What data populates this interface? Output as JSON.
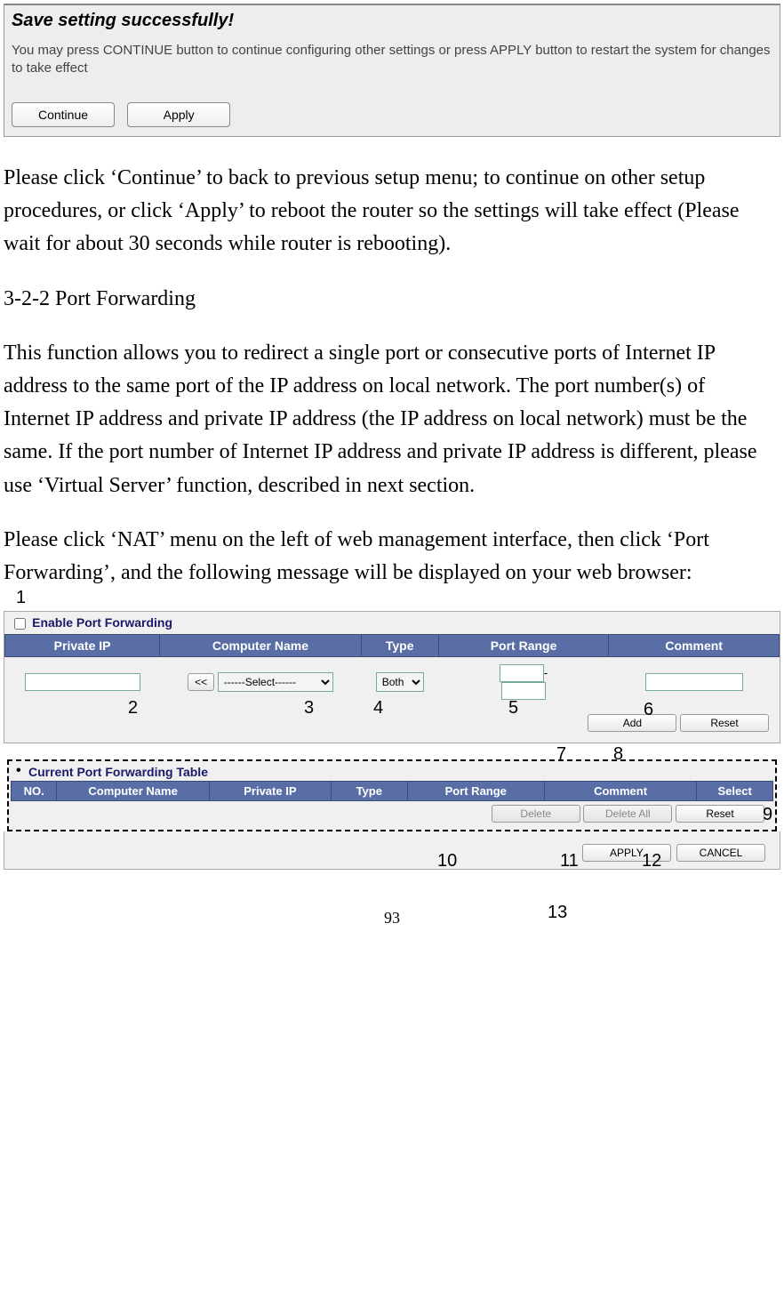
{
  "save_panel": {
    "title": "Save setting successfully!",
    "desc": "You may press CONTINUE button to continue configuring other settings or press APPLY button to restart the system for changes to take effect",
    "continue_label": "Continue",
    "apply_label": "Apply"
  },
  "para1": "Please click ‘Continue’ to back to previous setup menu; to continue on other setup procedures, or click ‘Apply’ to reboot the router so the settings will take effect (Please wait for about 30 seconds while router is rebooting).",
  "section_heading": "3-2-2 Port Forwarding",
  "para2": "This function allows you to redirect a single port or consecutive ports of Internet IP address to the same port of the IP address on local network. The port number(s) of Internet IP address and private IP address (the IP address on local network) must be the same. If the port number of Internet IP address and private IP address is different, please use ‘Virtual Server’ function, described in next section.",
  "para3": "Please click ‘NAT’ menu on the left of web management interface, then click ‘Port Forwarding’, and the following message will be displayed on your web browser:",
  "port_forwarding": {
    "enable_label": "Enable Port Forwarding",
    "headers": {
      "private_ip": "Private IP",
      "computer_name": "Computer Name",
      "type": "Type",
      "port_range": "Port Range",
      "comment": "Comment"
    },
    "computer_select": "------Select------",
    "ll_btn": "<<",
    "type_value": "Both",
    "port_sep": "-",
    "add_label": "Add",
    "reset_label": "Reset"
  },
  "current_table": {
    "title": "Current Port Forwarding Table",
    "headers": {
      "no": "NO.",
      "computer_name": "Computer Name",
      "private_ip": "Private IP",
      "type": "Type",
      "port_range": "Port Range",
      "comment": "Comment",
      "select": "Select"
    },
    "delete_label": "Delete",
    "delete_all_label": "Delete All",
    "reset_label": "Reset"
  },
  "apply_cancel": {
    "apply": "APPLY",
    "cancel": "CANCEL"
  },
  "callouts": {
    "c1": "1",
    "c2": "2",
    "c3": "3",
    "c4": "4",
    "c5": "5",
    "c6": "6",
    "c7": "7",
    "c8": "8",
    "c9": "9",
    "c10": "10",
    "c11": "11",
    "c12": "12",
    "c13": "13"
  },
  "page_number": "93"
}
